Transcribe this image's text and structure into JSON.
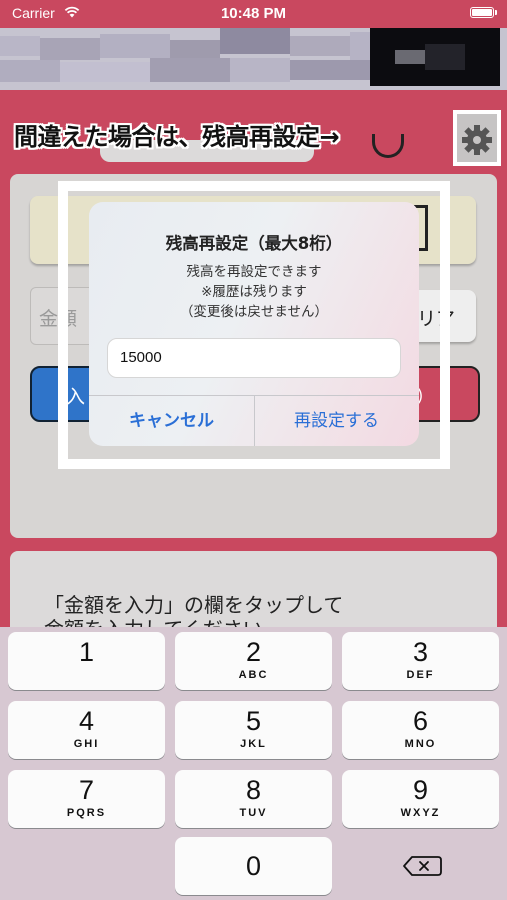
{
  "status_bar": {
    "carrier": "Carrier",
    "time": "10:48 PM"
  },
  "annotation": {
    "text": "間違えた場合は、残高再設定→"
  },
  "alert": {
    "title": "残高再設定（最大8桁）",
    "message_lines": [
      "残高を再設定できます",
      "※履歴は残ります",
      "（変更後は戻せません）"
    ],
    "input_value": "15000",
    "cancel_label": "キャンセル",
    "confirm_label": "再設定する"
  },
  "background": {
    "amount_placeholder_fragment": "金額",
    "clear_fragment": "クリア",
    "blue_button_fragment": "入",
    "red_button_fragment": "）"
  },
  "instructions": {
    "line1": "「金額を入力」の欄をタップして",
    "line2": "金額を入力してください"
  },
  "keyboard": {
    "keys": [
      {
        "num": "1",
        "letters": ""
      },
      {
        "num": "2",
        "letters": "ABC"
      },
      {
        "num": "3",
        "letters": "DEF"
      },
      {
        "num": "4",
        "letters": "GHI"
      },
      {
        "num": "5",
        "letters": "JKL"
      },
      {
        "num": "6",
        "letters": "MNO"
      },
      {
        "num": "7",
        "letters": "PQRS"
      },
      {
        "num": "8",
        "letters": "TUV"
      },
      {
        "num": "9",
        "letters": "WXYZ"
      },
      {
        "num": "0",
        "letters": ""
      }
    ]
  },
  "colors": {
    "accent_red": "#c9485f",
    "link_blue": "#2a6fd6",
    "keyboard_bg": "#d7c8d2"
  }
}
